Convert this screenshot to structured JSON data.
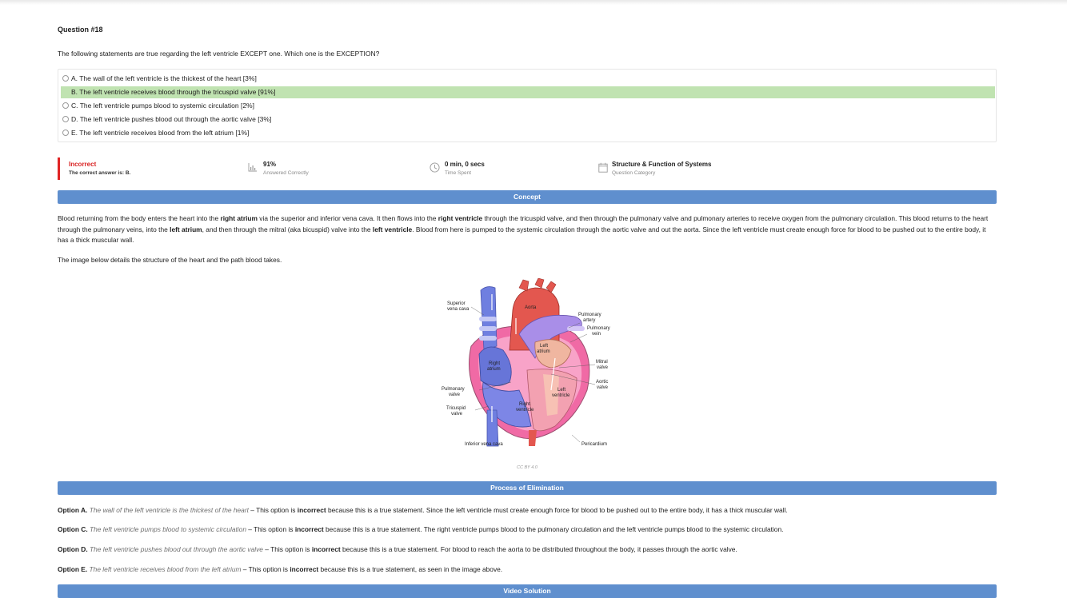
{
  "question": {
    "number": "Question #18",
    "text": "The following statements are true regarding the left ventricle EXCEPT one. Which one is the EXCEPTION?",
    "options": [
      {
        "label": "A. The wall of the left ventricle is the thickest of the heart [3%]"
      },
      {
        "label": "B. The left ventricle receives blood through the tricuspid valve [91%]",
        "highlighted": true
      },
      {
        "label": "C. The left ventricle pumps blood to systemic circulation [2%]"
      },
      {
        "label": "D. The left ventricle pushes blood out through the aortic valve [3%]"
      },
      {
        "label": "E. The left ventricle receives blood from the left atrium [1%]"
      }
    ]
  },
  "stats": {
    "result": {
      "title": "Incorrect",
      "sub_prefix": "The correct answer is: ",
      "sub_answer": "B."
    },
    "answered": {
      "title": "91%",
      "sub": "Answered Correctly",
      "icon": "bar-chart-icon"
    },
    "time": {
      "title": "0 min, 0 secs",
      "sub": "Time Spent",
      "icon": "clock-icon"
    },
    "category": {
      "title": "Structure & Function of Systems",
      "sub": "Question Category",
      "icon": "calendar-icon"
    },
    "colors": {
      "incorrect": "#d92323",
      "correct_highlight": "#c0e3b1",
      "section_bar": "#5f8fce"
    }
  },
  "concept": {
    "header": "Concept",
    "p1": {
      "a": "Blood returning from the body enters the heart into the ",
      "b": "right atrium",
      "c": " via the superior and inferior vena cava. It then flows into the ",
      "d": "right ventricle",
      "e": " through the tricuspid valve, and then through the pulmonary valve and pulmonary arteries to receive oxygen from the pulmonary circulation. This blood returns to the heart through the pulmonary veins, into the ",
      "f": "left atrium",
      "g": ", and then through the mitral (aka bicuspid) valve into the ",
      "h": "left ventricle",
      "i": ". Blood from here is pumped to the systemic circulation through the aortic valve and out the aorta. Since the left ventricle must create enough force for blood to be pushed out to the entire body, it has a thick muscular wall."
    },
    "p2": "The image below details the structure of the heart and the path blood takes.",
    "diagram_labels": {
      "superior_vena_cava_1": "Superior",
      "superior_vena_cava_2": "vena  cava",
      "aorta": "Aorta",
      "pulmonary_artery_1": "Pulmonary",
      "pulmonary_artery_2": "artery",
      "pulmonary_vein_1": "Pulmonary",
      "pulmonary_vein_2": "vein",
      "left_atrium_1": "Left",
      "left_atrium_2": "atrium",
      "right_atrium_1": "Right",
      "right_atrium_2": "atrium",
      "mitral_1": "Mitral",
      "mitral_2": "valve",
      "aortic_1": "Aortic",
      "aortic_2": "valve",
      "left_ventricle_1": "Left",
      "left_ventricle_2": "ventricle",
      "pulmonary_valve_1": "Pulmonary",
      "pulmonary_valve_2": "valve",
      "right_ventricle_1": "Right",
      "right_ventricle_2": "ventricle",
      "tricuspid_1": "Tricuspid",
      "tricuspid_2": "valve",
      "inferior_vena_cava": "Inferior vena cava",
      "pericardium": "Pericardium"
    },
    "credit": "CC BY 4.0"
  },
  "elimination": {
    "header": "Process of Elimination",
    "items": [
      {
        "opt": "Option A.",
        "stmt": "The wall of the left ventricle is the thickest of the heart",
        "dash": " – This option is ",
        "verdict": "incorrect",
        "reason": " because this is a true statement. Since the left ventricle must create enough force for blood to be pushed out to the entire body, it has a thick muscular wall."
      },
      {
        "opt": "Option C.",
        "stmt": "The left ventricle pumps blood to systemic circulation",
        "dash": " – This option is ",
        "verdict": "incorrect",
        "reason": " because this is a true statement. The right ventricle pumps blood to the pulmonary circulation and the left ventricle pumps blood to the systemic circulation."
      },
      {
        "opt": "Option D.",
        "stmt": "The left ventricle pushes blood out through the aortic valve",
        "dash": " – This option is ",
        "verdict": "incorrect",
        "reason": " because this is a true statement. For blood to reach the aorta to be distributed throughout the body, it passes through the aortic valve."
      },
      {
        "opt": "Option E.",
        "stmt": "The left ventricle receives blood from the left atrium",
        "dash": " – This option is ",
        "verdict": "incorrect",
        "reason": " because this is a true statement, as seen in the image above."
      }
    ]
  },
  "video": {
    "header": "Video Solution"
  }
}
